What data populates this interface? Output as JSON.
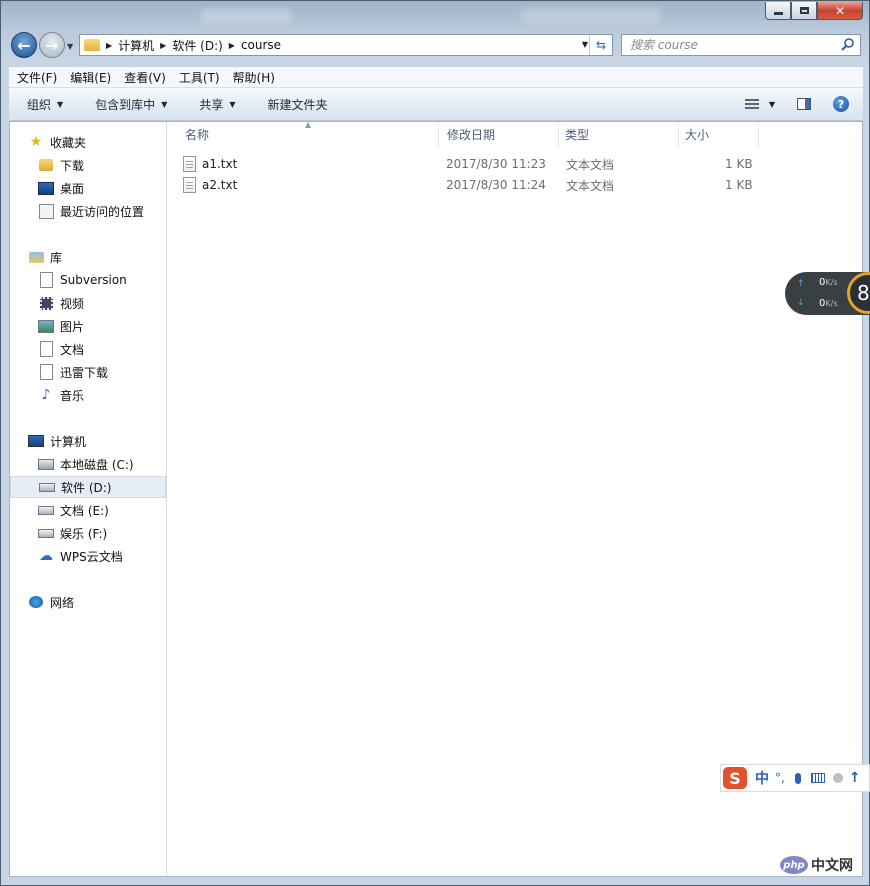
{
  "address": {
    "crumbs": [
      "计算机",
      "软件 (D:)",
      "course"
    ]
  },
  "search": {
    "placeholder": "搜索 course"
  },
  "menu": [
    "文件(F)",
    "编辑(E)",
    "查看(V)",
    "工具(T)",
    "帮助(H)"
  ],
  "toolbar": {
    "organize": "组织",
    "include_library": "包含到库中",
    "share": "共享",
    "new_folder": "新建文件夹"
  },
  "nav": {
    "favorites": {
      "label": "收藏夹",
      "items": [
        "下载",
        "桌面",
        "最近访问的位置"
      ]
    },
    "libraries": {
      "label": "库",
      "items": [
        "Subversion",
        "视频",
        "图片",
        "文档",
        "迅雷下载",
        "音乐"
      ]
    },
    "computer": {
      "label": "计算机",
      "items": [
        "本地磁盘 (C:)",
        "软件 (D:)",
        "文档 (E:)",
        "娱乐 (F:)",
        "WPS云文档"
      ]
    },
    "network": {
      "label": "网络"
    },
    "selected": "软件 (D:)"
  },
  "columns": [
    "名称",
    "修改日期",
    "类型",
    "大小"
  ],
  "files": [
    {
      "name": "a1.txt",
      "modified": "2017/8/30 11:23",
      "type": "文本文档",
      "size": "1 KB"
    },
    {
      "name": "a2.txt",
      "modified": "2017/8/30 11:24",
      "type": "文本文档",
      "size": "1 KB"
    }
  ],
  "speed_widget": {
    "up": "0",
    "up_unit": "K/s",
    "down": "0",
    "down_unit": "K/s",
    "badge": "8"
  },
  "ime": {
    "logo": "S",
    "mode": "中",
    "punct": "°,"
  },
  "watermark": {
    "logo": "php",
    "text": "中文网"
  },
  "colors": {
    "accent": "#2e6db3",
    "ime_logo": "#e2512b",
    "speed_ring": "#e6a227"
  }
}
